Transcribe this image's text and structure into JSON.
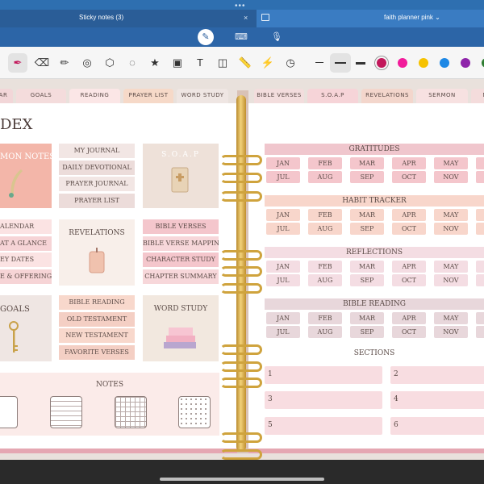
{
  "app": {
    "tab_active": "Sticky notes (3)",
    "tab_close": "×",
    "tab_other": "faith planner pink",
    "tab_other_caret": "⌄",
    "dots": "•••"
  },
  "modes": {
    "pen_icon": "✎",
    "keyboard_icon": "⌨",
    "mic_icon": "🎙"
  },
  "toolbar": {
    "tools": [
      {
        "name": "pen-tool",
        "glyph": "✒"
      },
      {
        "name": "eraser-tool",
        "glyph": "⌫"
      },
      {
        "name": "highlighter-tool",
        "glyph": "✏"
      },
      {
        "name": "shape-tool",
        "glyph": "◎"
      },
      {
        "name": "lasso-shapes-tool",
        "glyph": "⬡"
      },
      {
        "name": "lasso-tool",
        "glyph": "◌"
      },
      {
        "name": "sticker-tool",
        "glyph": "★"
      },
      {
        "name": "image-tool",
        "glyph": "▣"
      },
      {
        "name": "text-tool",
        "glyph": "T"
      },
      {
        "name": "camera-tool",
        "glyph": "◫"
      },
      {
        "name": "ruler-tool",
        "glyph": "📏"
      },
      {
        "name": "laser-tool",
        "glyph": "⚡"
      },
      {
        "name": "clock-tool",
        "glyph": "◷"
      }
    ],
    "colors": [
      "#c2185b",
      "#f21c9b",
      "#f6c200",
      "#1e88e5",
      "#8e24aa",
      "#2e7d32"
    ]
  },
  "planner": {
    "tabs": [
      "AR",
      "GOALS",
      "READING",
      "PRAYER LIST",
      "WORD STUDY",
      "BIBLE VERSES",
      "S.O.A.P",
      "REVELATIONS",
      "SERMON",
      "MY"
    ],
    "index_title": "DEX",
    "cards": {
      "sermon_notes": "MON NOTES",
      "journal": [
        "MY JOURNAL",
        "DAILY DEVOTIONAL",
        "PRAYER JOURNAL",
        "PRAYER LIST"
      ],
      "soap": "S.O.A.P",
      "calendar": [
        "ALENDAR",
        "AT A GLANCE",
        "EY DATES",
        "E & OFFERING"
      ],
      "revelations": "REVELATIONS",
      "verses": [
        "BIBLE VERSES",
        "BIBLE VERSE MAPPING",
        "CHARACTER STUDY",
        "CHAPTER SUMMARY"
      ],
      "goals": "GOALS",
      "reading": [
        "BIBLE READING",
        "OLD TESTAMENT",
        "NEW TESTAMENT",
        "FAVORITE VERSES"
      ],
      "word_study": "WORD STUDY",
      "notes": "NOTES"
    },
    "trackers": [
      {
        "title": "GRATITUDES",
        "months": [
          "JAN",
          "FEB",
          "MAR",
          "APR",
          "MAY",
          "JUL",
          "AUG",
          "SEP",
          "OCT",
          "NOV"
        ],
        "header": "#f0c6cd",
        "pill": "#f4c6cc"
      },
      {
        "title": "HABIT TRACKER",
        "months": [
          "JAN",
          "FEB",
          "MAR",
          "APR",
          "MAY",
          "JUL",
          "AUG",
          "SEP",
          "OCT",
          "NOV"
        ],
        "header": "#f8d6cb",
        "pill": "#f8d6cb"
      },
      {
        "title": "REFLECTIONS",
        "months": [
          "JAN",
          "FEB",
          "MAR",
          "APR",
          "MAY",
          "JUL",
          "AUG",
          "SEP",
          "OCT",
          "NOV"
        ],
        "header": "#f4dde3",
        "pill": "#f4dde3"
      },
      {
        "title": "BIBLE READING",
        "months": [
          "JAN",
          "FEB",
          "MAR",
          "APR",
          "MAY",
          "JUL",
          "AUG",
          "SEP",
          "OCT",
          "NOV"
        ],
        "header": "#e8d7db",
        "pill": "#e8d7db"
      }
    ],
    "sections_title": "SECTIONS",
    "sections": [
      "1",
      "2",
      "3",
      "4",
      "5",
      "6"
    ]
  }
}
